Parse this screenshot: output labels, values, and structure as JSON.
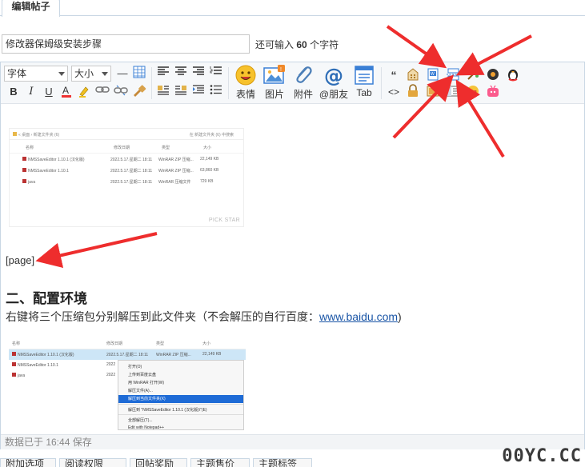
{
  "tabbar": {
    "active_tab": "编辑帖子"
  },
  "subject": {
    "value": "修改器保姆级安装步骤",
    "hint_prefix": "还可输入",
    "hint_count": "60",
    "hint_suffix": "个字符"
  },
  "toolbar": {
    "font_select": "字体",
    "size_select": "大小",
    "big_buttons": [
      {
        "label": "表情",
        "icon": "smiley-icon"
      },
      {
        "label": "图片",
        "icon": "image-icon"
      },
      {
        "label": "附件",
        "icon": "paperclip-icon"
      },
      {
        "label": "@朋友",
        "icon": "at-icon"
      },
      {
        "label": "Tab",
        "icon": "tab-icon"
      }
    ]
  },
  "content": {
    "shot1": {
      "breadcrumb": "« 桌面 › 新建文件夹 (6)",
      "search": "在 新建文件夹 (6) 中搜索",
      "headers": [
        "名称",
        "修改日期",
        "类型",
        "大小"
      ],
      "rows": [
        [
          "NMSSaveEditor 1.10.1 (汉化版)",
          "2022.5.17.星期二 18:11",
          "WinRAR ZIP 压缩...",
          "22,149 KB"
        ],
        [
          "NMSSaveEditor 1.10.1",
          "2022.5.17.星期二 18:11",
          "WinRAR ZIP 压缩...",
          "63,860 KB"
        ],
        [
          "java",
          "2022.5.17.星期二 18:11",
          "WinRAR 压缩文件",
          "729 KB"
        ]
      ],
      "watermark": "PICK STAR"
    },
    "page_tag": "[page]",
    "heading": "二、配置环境",
    "para_text": "右键将三个压缩包分别解压到此文件夹（不会解压的自行百度：",
    "para_link": "www.baidu.com",
    "para_end": ")",
    "shot2": {
      "headers": [
        "名称",
        "修改日期",
        "类型",
        "大小"
      ],
      "rows": [
        [
          "NMSSaveEditor 1.10.1 (汉化版)",
          "2022.5.17.星期二 18:11",
          "WinRAR ZIP 压缩...",
          "22,149 KB"
        ],
        [
          "NMSSaveEditor 1.10.1",
          "2022",
          "",
          ""
        ],
        [
          "java",
          "2022",
          "",
          ""
        ]
      ],
      "menu": [
        "打开(O)",
        "上传到百度云盘",
        "用 WinRAR 打开(W)",
        "解压文件(A)...",
        "解压到当前文件夹(X)",
        "解压到 \"NMSSaveEditor 1.10.1 (汉化版)\\\"(E)",
        "全部解压(T)...",
        "Edit with Notepad++"
      ]
    }
  },
  "status": "数据已于 16:44 保存",
  "options_tabs": [
    "附加选项",
    "阅读权限",
    "回帖奖励",
    "主题售价",
    "主题标签"
  ],
  "site_mark": "00YC.CC",
  "colors": {
    "arrow": "#ee2d2d",
    "link": "#1a55a6",
    "border": "#c9d7e4"
  }
}
